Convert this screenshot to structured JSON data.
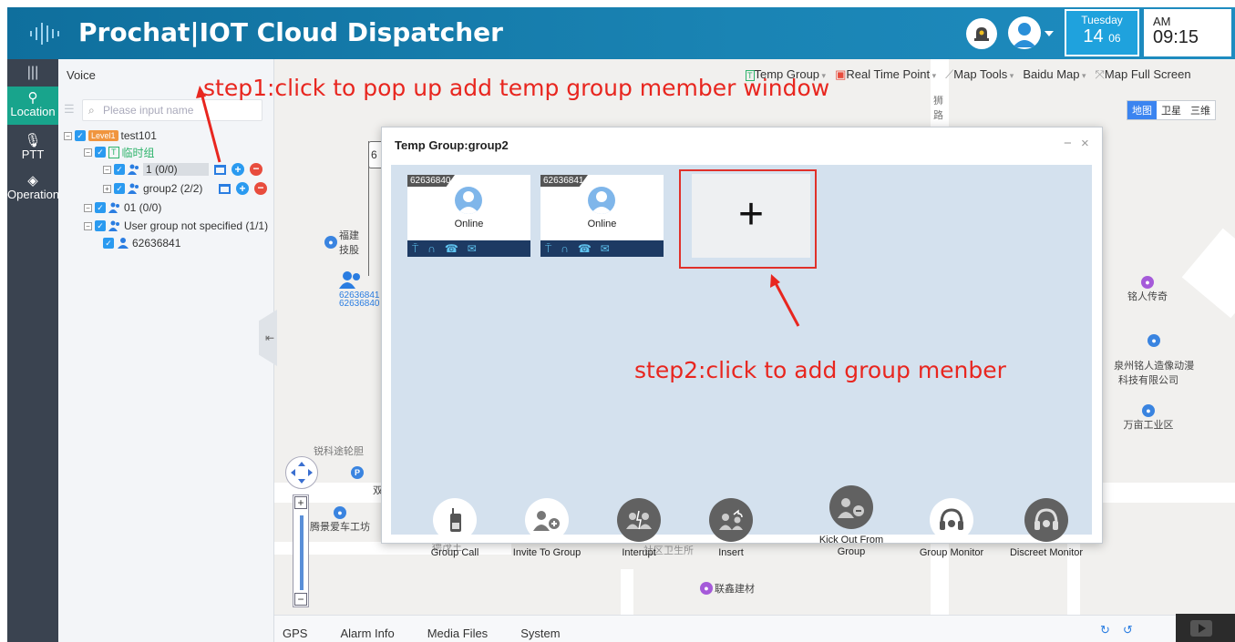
{
  "header": {
    "app_title": "Prochat|IOT Cloud Dispatcher",
    "date_day": "Tuesday",
    "date_num": "14",
    "date_month": "06",
    "time_ampm": "AM",
    "time": "09:15"
  },
  "nav": {
    "location": "Location",
    "ptt": "PTT",
    "operation": "Operation"
  },
  "tree": {
    "voice_label": "Voice",
    "search_placeholder": "Please input name",
    "level_badge": "Level1",
    "root": "test101",
    "temp_badge": "T",
    "temp_group": "临时组",
    "group1": "1 (0/0)",
    "group2": "group2 (2/2)",
    "group01": "01 (0/0)",
    "unspecified": "User group not specified (1/1)",
    "user": "62636841"
  },
  "map": {
    "toolbar": [
      "Temp Group",
      "Real Time Point",
      "Map Tools",
      "Baidu Map",
      "Map Full Screen"
    ],
    "types": [
      "地图",
      "卫星",
      "三维"
    ],
    "pois": {
      "shi_road": "狮\n路",
      "fujian": "福建\n技股",
      "mingren": "铭人传奇",
      "quanzhou": "泉州铭人造像动漫\n科技有限公司",
      "wanmu": "万亩工业区",
      "ruike": "锐科途轮胆",
      "shuang": "双",
      "tengjing": "腾景爱车工坊",
      "community": "社区卫生所",
      "lianxin": "联鑫建材",
      "jiemao": "德茂王",
      "marker_ids": "62636841\n62636840"
    }
  },
  "dialog": {
    "title": "Temp Group:group2",
    "members": [
      {
        "id": "62636840",
        "status": "Online"
      },
      {
        "id": "62636841",
        "status": "Online"
      }
    ],
    "add_symbol": "+",
    "actions": [
      {
        "label": "Group Call"
      },
      {
        "label": "Invite To Group"
      },
      {
        "label": "Interupt"
      },
      {
        "label": "Insert"
      },
      {
        "label": "Kick Out From Group"
      },
      {
        "label": "Group Monitor"
      },
      {
        "label": "Discreet Monitor"
      }
    ]
  },
  "bottom": {
    "tabs": [
      "GPS",
      "Alarm Info",
      "Media Files",
      "System"
    ]
  },
  "annotations": {
    "step1": "step1:click to pop up add temp group member window",
    "step2": "step2:click to add group menber"
  },
  "colors": {
    "header": "#1a84b4",
    "nav_active": "#18a48c",
    "annotation": "#e8261f",
    "dialog_body": "#d4e1ee"
  }
}
